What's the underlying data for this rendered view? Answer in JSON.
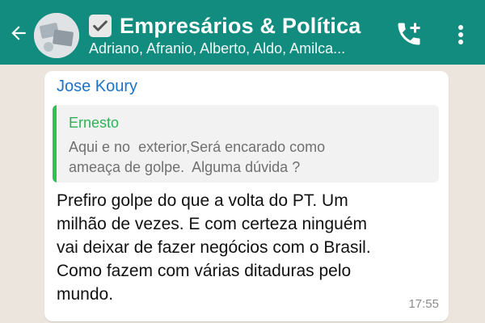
{
  "header": {
    "title": "Empresários & Política",
    "members": "Adriano, Afranio, Alberto, Aldo, Amilca...",
    "icons": {
      "back": "arrow-left-icon",
      "avatar": "group-avatar",
      "title_badge": "checkbox-icon",
      "call": "add-call-icon",
      "menu": "more-vert-icon"
    },
    "color": "#128c7e"
  },
  "message": {
    "sender": "Jose Koury",
    "sender_color": "#1c73c9",
    "quote": {
      "author": "Ernesto",
      "author_color": "#2db255",
      "text": "Aqui e no  exterior,Será encarado como\nameaça de golpe.  Alguma dúvida ?"
    },
    "text": "Prefiro golpe do que a volta do PT. Um\nmilhão de vezes. E com certeza ninguém\nvai deixar de fazer negócios com o Brasil.\nComo fazem com várias ditaduras pelo\nmundo.",
    "time": "17:55"
  }
}
